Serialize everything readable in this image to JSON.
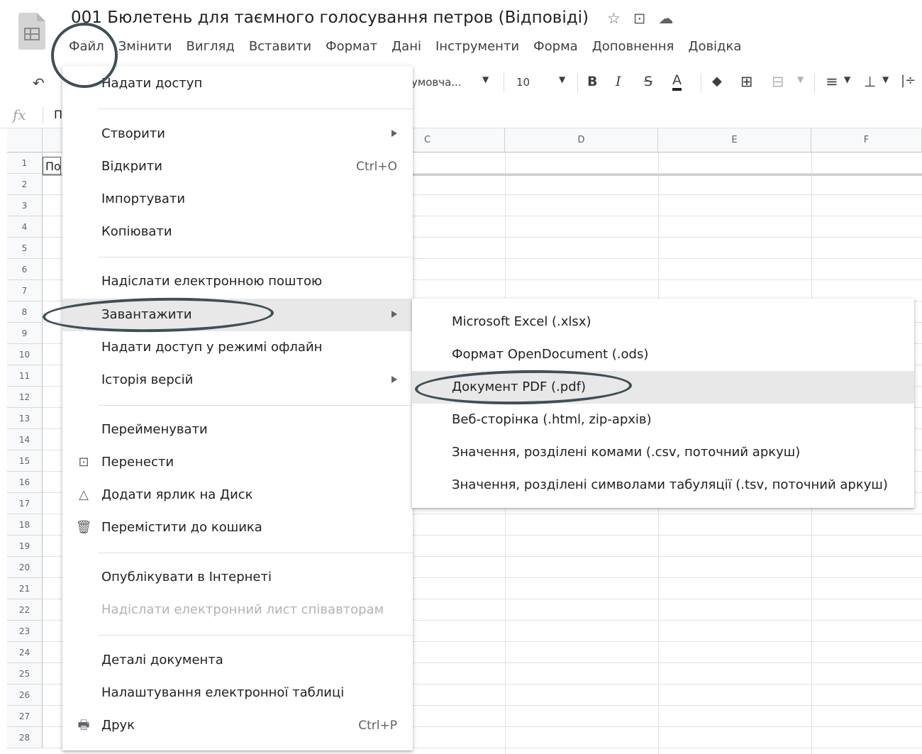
{
  "app": {
    "title": "001 Бюлетень для таємного голосування петров (Відповіді)",
    "title_icons": [
      "☆",
      "⊡",
      "☁"
    ]
  },
  "menubar": [
    "Файл",
    "Змінити",
    "Вигляд",
    "Вставити",
    "Формат",
    "Дані",
    "Інструменти",
    "Форма",
    "Доповнення",
    "Довідка"
  ],
  "toolbar": {
    "undo": "↶",
    "font_name": "умовча...",
    "font_size": "10",
    "bold": "B",
    "italic": "I",
    "strike": "S",
    "text_color": "A",
    "fill": "◆",
    "borders": "⊞",
    "merge": "⊟",
    "halign": "≡",
    "valign": "⊥",
    "wrap": "|÷"
  },
  "formula_bar": {
    "fx": "fx",
    "value": "П"
  },
  "grid": {
    "columns": [
      "C",
      "D",
      "E",
      "F"
    ],
    "rows": [
      "1",
      "2",
      "3",
      "4",
      "5",
      "6",
      "7",
      "8",
      "9",
      "10",
      "11",
      "12",
      "13",
      "14",
      "15",
      "16",
      "17",
      "18",
      "19",
      "20",
      "21",
      "22",
      "23",
      "24",
      "25",
      "26",
      "27",
      "28"
    ],
    "a1_value": "По"
  },
  "file_menu": {
    "items": [
      {
        "label": "Надати доступ"
      },
      {
        "label": "Створити",
        "submenu": true
      },
      {
        "label": "Відкрити",
        "shortcut": "Ctrl+O"
      },
      {
        "label": "Імпортувати"
      },
      {
        "label": "Копіювати"
      },
      {
        "label": "Надіслати електронною поштою"
      },
      {
        "label": "Завантажити",
        "submenu": true,
        "highlighted": true
      },
      {
        "label": "Надати доступ у режимі офлайн"
      },
      {
        "label": "Історія версій",
        "submenu": true
      },
      {
        "label": "Перейменувати"
      },
      {
        "label": "Перенести",
        "icon": "folder-move-icon"
      },
      {
        "label": "Додати ярлик на Диск",
        "icon": "drive-shortcut-icon"
      },
      {
        "label": "Перемістити до кошика",
        "icon": "trash-icon"
      },
      {
        "label": "Опублікувати в Інтернеті"
      },
      {
        "label": "Надіслати електронний лист співавторам",
        "disabled": true
      },
      {
        "label": "Деталі документа"
      },
      {
        "label": "Налаштування електронної таблиці"
      },
      {
        "label": "Друк",
        "shortcut": "Ctrl+P",
        "icon": "print-icon"
      }
    ]
  },
  "download_submenu": {
    "items": [
      {
        "label": "Microsoft Excel (.xlsx)"
      },
      {
        "label": "Формат OpenDocument (.ods)"
      },
      {
        "label": "Документ PDF (.pdf)",
        "highlighted": true
      },
      {
        "label": "Веб-сторінка (.html, zip-архів)"
      },
      {
        "label": "Значення, розділені комами (.csv, поточний аркуш)"
      },
      {
        "label": "Значення, розділені символами табуляції (.tsv, поточний аркуш)"
      }
    ]
  },
  "colors": {
    "highlight": "#e8e8e8",
    "annotation_ring": "#3f4f55",
    "disabled_text": "#b0b3b8"
  }
}
